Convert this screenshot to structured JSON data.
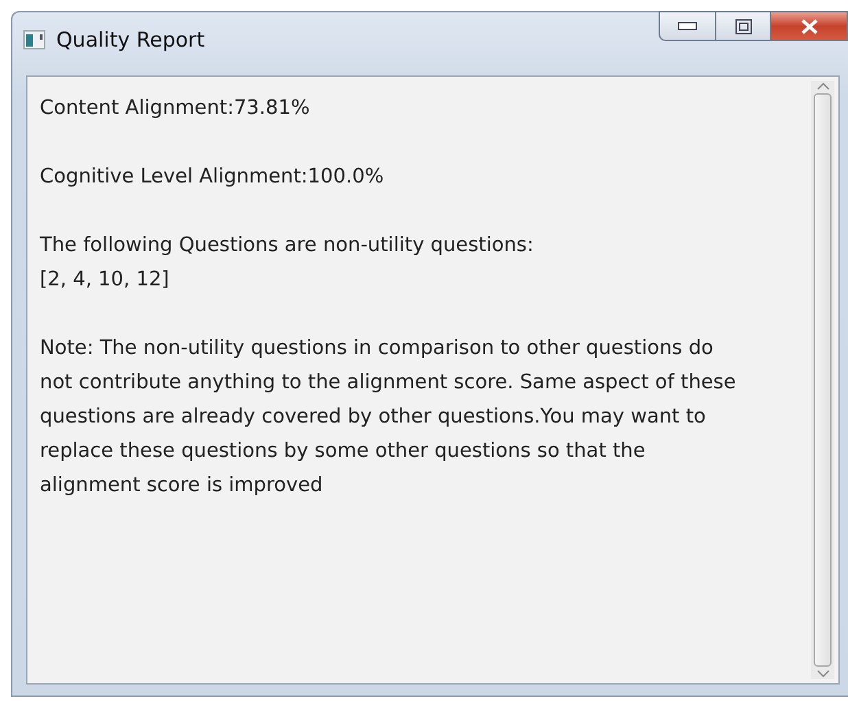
{
  "window": {
    "title": "Quality Report"
  },
  "paragraphs": [
    [
      "Content Alignment:73.81%"
    ],
    [
      "Cognitive Level Alignment:100.0%"
    ],
    [
      "The following Questions are non-utility questions:",
      "[2, 4, 10, 12]"
    ],
    [
      "Note: The non-utility questions in comparison to other questions do",
      "not contribute anything to the alignment score. Same aspect of these",
      "questions are already covered by other questions.You may want to",
      "replace these questions by some other questions so that the",
      "alignment score is improved"
    ]
  ]
}
